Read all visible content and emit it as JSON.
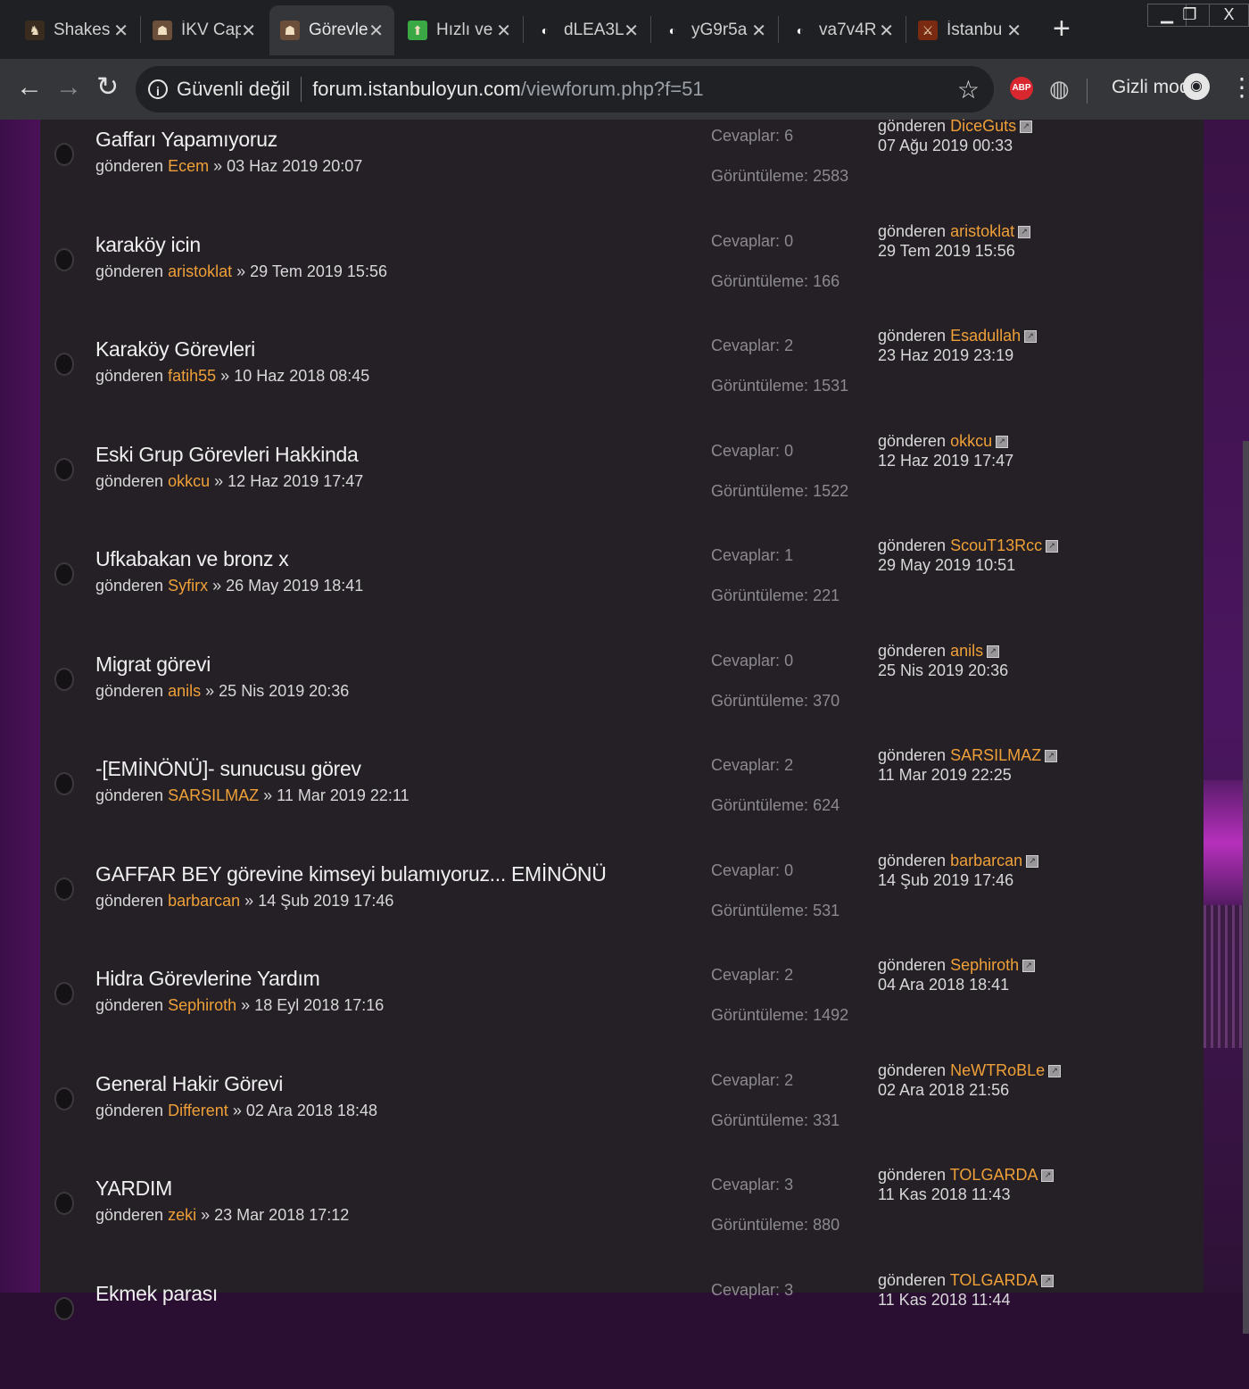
{
  "browser": {
    "tabs": [
      {
        "title": "Shakes",
        "favicon": "game-icon",
        "fav_color": "#3a2b1f"
      },
      {
        "title": "İKV Cap",
        "favicon": "forum-avatar-icon",
        "fav_color": "#6b4f3a"
      },
      {
        "title": "Görevle",
        "favicon": "forum-avatar-icon",
        "fav_color": "#6b4f3a"
      },
      {
        "title": "Hızlı ve",
        "favicon": "upload-arrow-icon",
        "fav_color": "#3aa845"
      },
      {
        "title": "dLEA3L",
        "favicon": "globe-icon",
        "fav_color": "#1f2023"
      },
      {
        "title": "yG9r5a",
        "favicon": "globe-icon",
        "fav_color": "#1f2023"
      },
      {
        "title": "va7v4R",
        "favicon": "globe-icon",
        "fav_color": "#1f2023"
      },
      {
        "title": "İstanbu",
        "favicon": "iko-logo-icon",
        "fav_color": "#7a2a10"
      }
    ],
    "active_tab": 2,
    "security_label": "Güvenli değil",
    "url_host": "forum.istanbuloyun.com",
    "url_path": "/viewforum.php?f=51",
    "incognito_label": "Gizli mod",
    "abp_label": "ABP"
  },
  "labels": {
    "by": "gönderen",
    "sep": "»",
    "replies_prefix": "Cevaplar:",
    "views_prefix": "Görüntüleme:"
  },
  "topics": [
    {
      "title": "Gaffarı Yapamıyoruz",
      "author": "Ecem",
      "date": "03 Haz 2019 20:07",
      "replies": "6",
      "views": "2583",
      "last_by": "DiceGuts",
      "last_date": "07 Ağu 2019 00:33"
    },
    {
      "title": "karaköy icin",
      "author": "aristoklat",
      "date": "29 Tem 2019 15:56",
      "replies": "0",
      "views": "166",
      "last_by": "aristoklat",
      "last_date": "29 Tem 2019 15:56"
    },
    {
      "title": "Karaköy Görevleri",
      "author": "fatih55",
      "date": "10 Haz 2018 08:45",
      "replies": "2",
      "views": "1531",
      "last_by": "Esadullah",
      "last_date": "23 Haz 2019 23:19"
    },
    {
      "title": "Eski Grup Görevleri Hakkinda",
      "author": "okkcu",
      "date": "12 Haz 2019 17:47",
      "replies": "0",
      "views": "1522",
      "last_by": "okkcu",
      "last_date": "12 Haz 2019 17:47"
    },
    {
      "title": "Ufkabakan ve bronz x",
      "author": "Syfirx",
      "date": "26 May 2019 18:41",
      "replies": "1",
      "views": "221",
      "last_by": "ScouT13Rcc",
      "last_date": "29 May 2019 10:51"
    },
    {
      "title": "Migrat görevi",
      "author": "anils",
      "date": "25 Nis 2019 20:36",
      "replies": "0",
      "views": "370",
      "last_by": "anils",
      "last_date": "25 Nis 2019 20:36"
    },
    {
      "title": "-[EMİNÖNÜ]- sunucusu görev",
      "author": "SARSILMAZ",
      "date": "11 Mar 2019 22:11",
      "replies": "2",
      "views": "624",
      "last_by": "SARSILMAZ",
      "last_date": "11 Mar 2019 22:25"
    },
    {
      "title": "GAFFAR BEY görevine kimseyi bulamıyoruz... EMİNÖNÜ",
      "author": "barbarcan",
      "date": "14 Şub 2019 17:46",
      "replies": "0",
      "views": "531",
      "last_by": "barbarcan",
      "last_date": "14 Şub 2019 17:46"
    },
    {
      "title": "Hidra Görevlerine Yardım",
      "author": "Sephiroth",
      "date": "18 Eyl 2018 17:16",
      "replies": "2",
      "views": "1492",
      "last_by": "Sephiroth",
      "last_date": "04 Ara 2018 18:41"
    },
    {
      "title": "General Hakir Görevi",
      "author": "Different",
      "date": "02 Ara 2018 18:48",
      "replies": "2",
      "views": "331",
      "last_by": "NeWTRoBLe",
      "last_date": "02 Ara 2018 21:56"
    },
    {
      "title": "YARDIM",
      "author": "zeki",
      "date": "23 Mar 2018 17:12",
      "replies": "3",
      "views": "880",
      "last_by": "TOLGARDA",
      "last_date": "11 Kas 2018 11:43"
    },
    {
      "title": "Ekmek parası",
      "author": "",
      "date": "",
      "replies": "3",
      "views": "",
      "last_by": "TOLGARDA",
      "last_date": "11 Kas 2018 11:44"
    }
  ]
}
